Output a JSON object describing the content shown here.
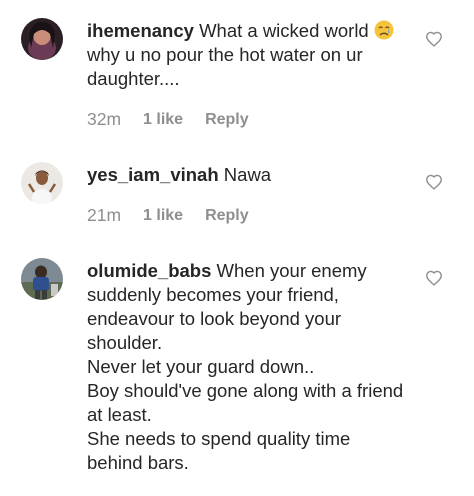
{
  "comments": [
    {
      "username": "ihemenancy",
      "text_line1": " What a wicked world ",
      "emoji": "crying-face-emoji",
      "text_rest": "why u no pour the hot water on ur daughter....",
      "time": "32m",
      "likes": "1 like",
      "reply": "Reply"
    },
    {
      "username": "yes_iam_vinah",
      "text": " Nawa",
      "time": "21m",
      "likes": "1 like",
      "reply": "Reply"
    },
    {
      "username": "olumide_babs",
      "text": " When your enemy suddenly becomes your friend, endeavour to look beyond your shoulder.\nNever let your guard down..\nBoy should've gone along with a friend at least.\nShe needs to spend quality time behind bars."
    }
  ],
  "icons": {
    "like": "heart-outline-icon"
  },
  "colors": {
    "text": "#262626",
    "meta": "#8e8e8e",
    "background": "#ffffff"
  }
}
